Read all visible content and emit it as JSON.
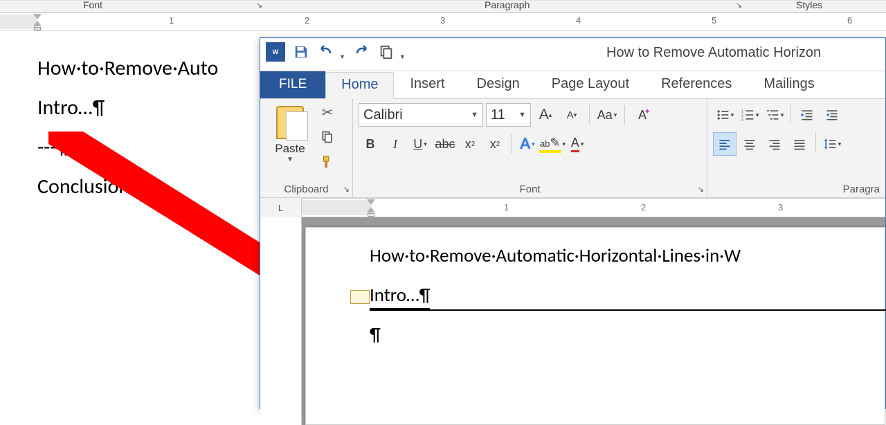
{
  "bg_ribbon": {
    "font_label": "Font",
    "paragraph_label": "Paragraph",
    "styles_label": "Styles"
  },
  "bg_ruler_numbers": [
    "1",
    "2",
    "3",
    "4",
    "5",
    "6"
  ],
  "bg_doc": {
    "title": "How·to·Remove·Auto",
    "intro": "Intro…¶",
    "dashes": "---¶",
    "conclusion": "Conclusion…¶"
  },
  "fg": {
    "doc_title": "How to Remove Automatic Horizon",
    "tabs": {
      "file": "FILE",
      "home": "Home",
      "insert": "Insert",
      "design": "Design",
      "page_layout": "Page Layout",
      "references": "References",
      "mailings": "Mailings"
    },
    "clipboard": {
      "paste": "Paste",
      "label": "Clipboard"
    },
    "font": {
      "name": "Calibri",
      "size": "11",
      "label": "Font",
      "grow": "A",
      "shrink": "A",
      "change_case": "Aa",
      "bold": "B",
      "italic": "I",
      "underline": "U",
      "strike": "abc",
      "sub": "x",
      "sub_s": "2",
      "sup": "x",
      "sup_s": "2",
      "text_effects": "A",
      "highlight": "ab",
      "font_color": "A"
    },
    "paragraph": {
      "label": "Paragra"
    },
    "ruler_corner": "L",
    "ruler_numbers": [
      "1",
      "2",
      "3"
    ]
  },
  "fg_doc": {
    "title": "How·to·Remove·Automatic·Horizontal·Lines·in·W",
    "intro": "Intro…¶",
    "blank": "¶"
  }
}
